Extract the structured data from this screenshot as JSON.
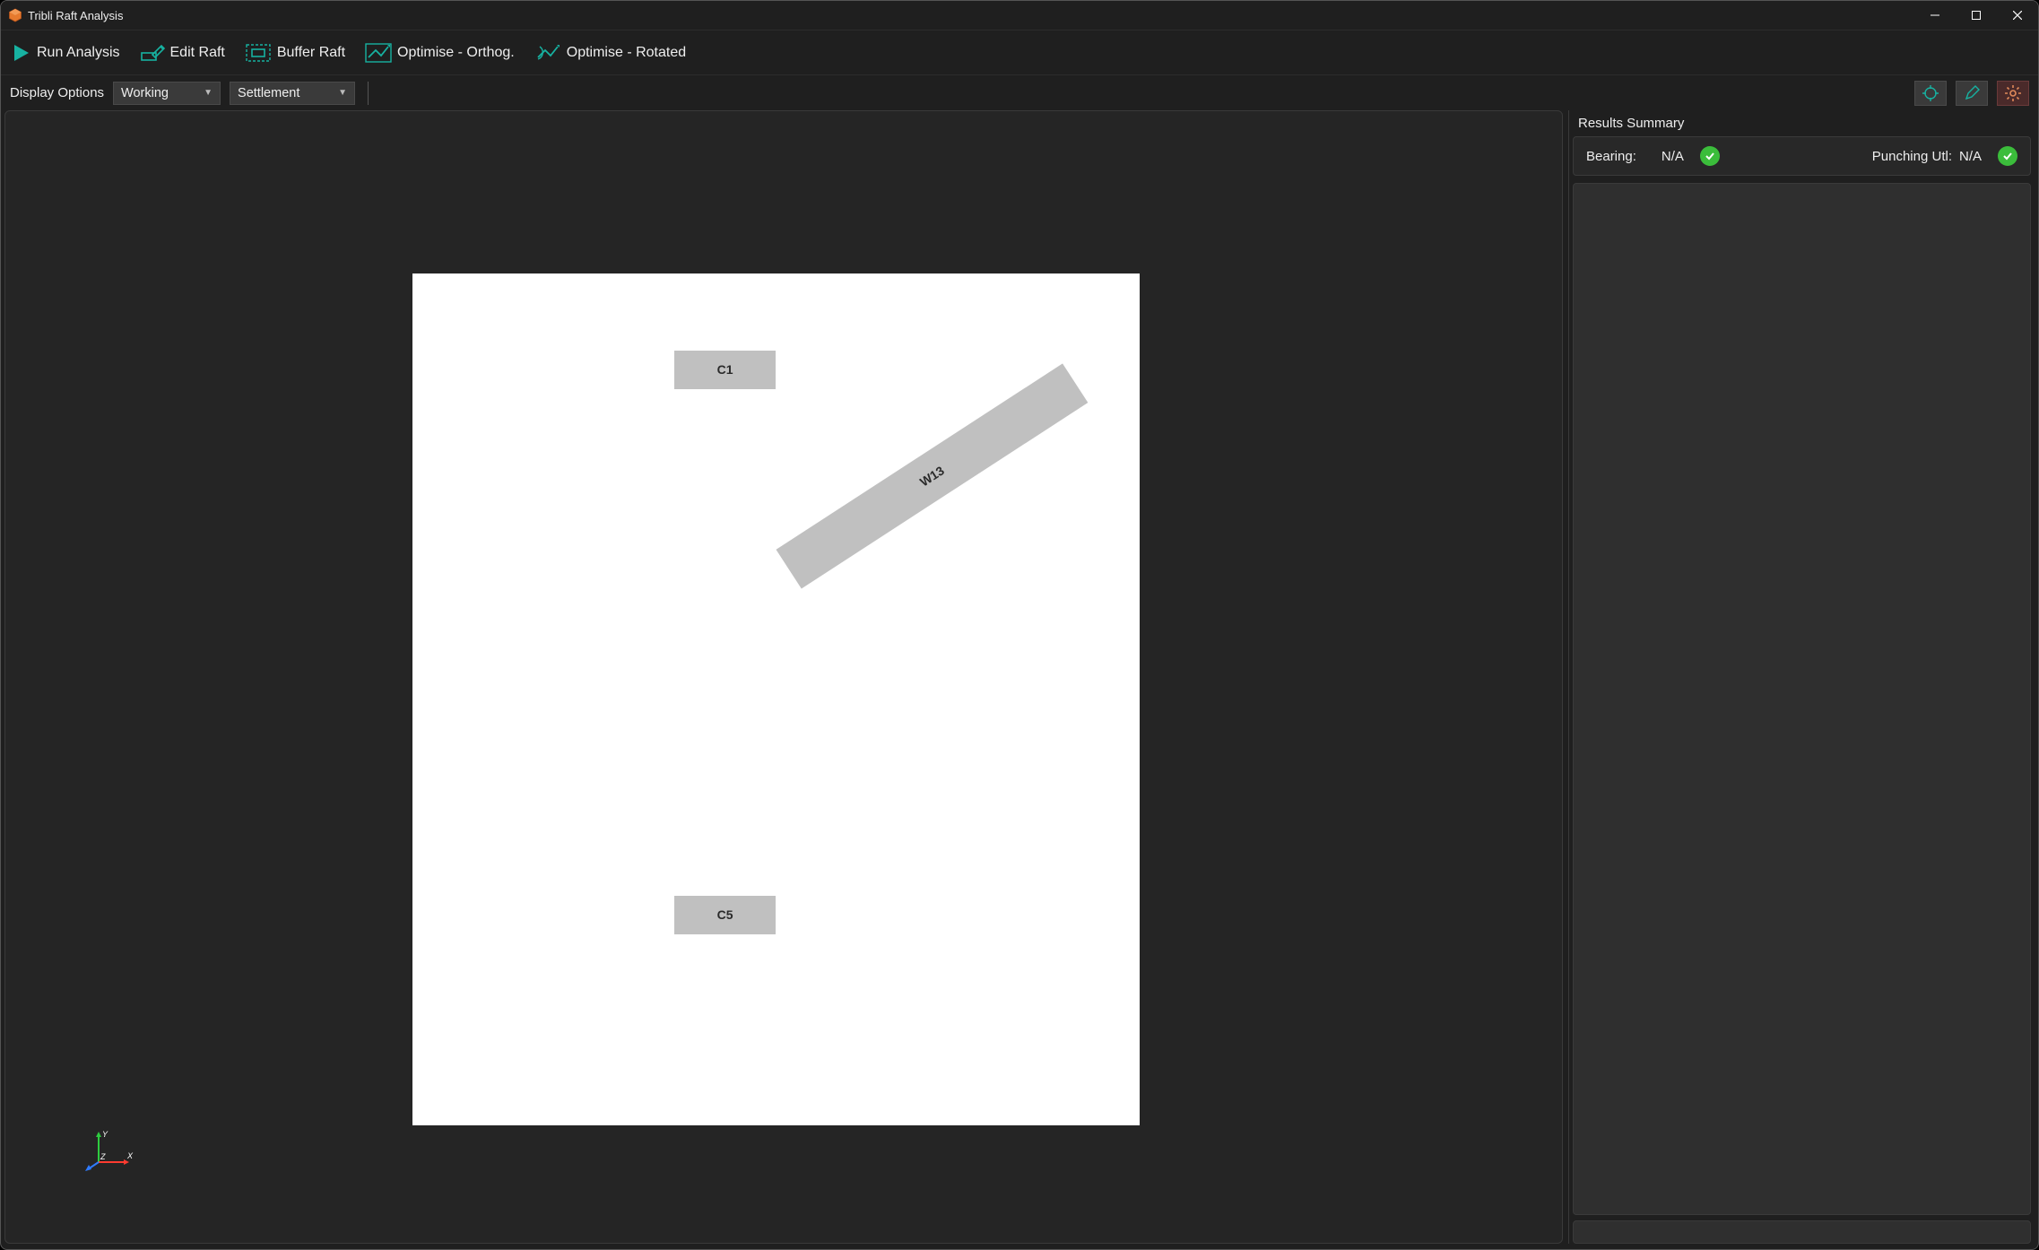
{
  "window": {
    "title": "Tribli Raft Analysis"
  },
  "toolbar": {
    "run": "Run Analysis",
    "edit": "Edit Raft",
    "buffer": "Buffer Raft",
    "opt_orthog": "Optimise - Orthog.",
    "opt_rotated": "Optimise - Rotated"
  },
  "options": {
    "label": "Display Options",
    "combo1": "Working",
    "combo2": "Settlement"
  },
  "panel": {
    "title": "Results Summary",
    "bearing_label": "Bearing:",
    "bearing_value": "N/A",
    "punching_label": "Punching Utl:",
    "punching_value": "N/A"
  },
  "viewport": {
    "elements": {
      "c1": "C1",
      "w13": "W13",
      "c5": "C5"
    },
    "axes": {
      "x": "X",
      "y": "Y",
      "z": "Z"
    }
  },
  "colors": {
    "accent_teal": "#17b2a1",
    "accent_orange": "#e67a2e",
    "ok_green": "#3bbd3b"
  }
}
